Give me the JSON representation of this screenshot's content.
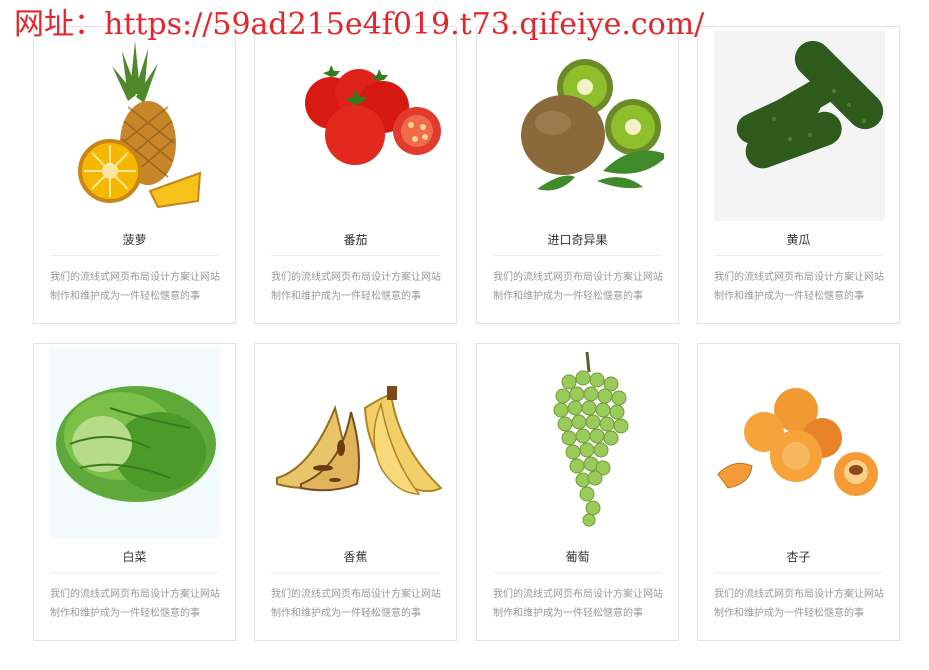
{
  "watermark": "网址：https://59ad215e4f019.t73.qifeiye.com/",
  "products": [
    {
      "name": "菠萝",
      "icon": "pineapple-image",
      "desc": "我们的流线式网页布局设计方案让网站制作和维护成为一件轻松惬意的事"
    },
    {
      "name": "番茄",
      "icon": "tomato-image",
      "desc": "我们的流线式网页布局设计方案让网站制作和维护成为一件轻松惬意的事"
    },
    {
      "name": "进口奇异果",
      "icon": "kiwi-image",
      "desc": "我们的流线式网页布局设计方案让网站制作和维护成为一件轻松惬意的事"
    },
    {
      "name": "黄瓜",
      "icon": "cucumber-image",
      "desc": "我们的流线式网页布局设计方案让网站制作和维护成为一件轻松惬意的事"
    },
    {
      "name": "白菜",
      "icon": "cabbage-image",
      "desc": "我们的流线式网页布局设计方案让网站制作和维护成为一件轻松惬意的事"
    },
    {
      "name": "香蕉",
      "icon": "banana-image",
      "desc": "我们的流线式网页布局设计方案让网站制作和维护成为一件轻松惬意的事"
    },
    {
      "name": "葡萄",
      "icon": "grape-image",
      "desc": "我们的流线式网页布局设计方案让网站制作和维护成为一件轻松惬意的事"
    },
    {
      "name": "杏子",
      "icon": "apricot-image",
      "desc": "我们的流线式网页布局设计方案让网站制作和维护成为一件轻松惬意的事"
    }
  ]
}
